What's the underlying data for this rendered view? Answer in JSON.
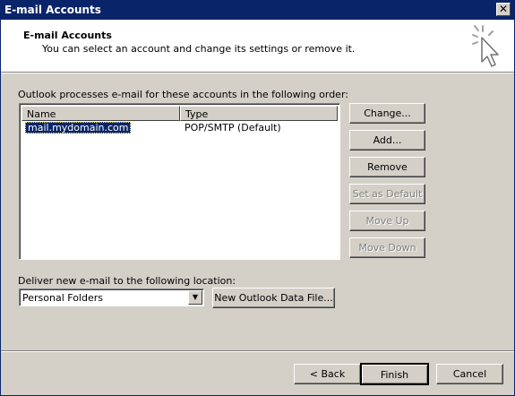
{
  "window": {
    "title": "E-mail Accounts",
    "close_glyph": "✕"
  },
  "header": {
    "title": "E-mail Accounts",
    "subtitle": "You can select an account and change its settings or remove it.",
    "icon": "cursor-sparkle-icon"
  },
  "accounts": {
    "label": "Outlook processes e-mail for these accounts in the following order:",
    "columns": [
      "Name",
      "Type"
    ],
    "rows": [
      {
        "name": "mail.mydomain.com",
        "type": "POP/SMTP (Default)"
      }
    ]
  },
  "side_buttons": {
    "change": "Change...",
    "add": "Add...",
    "remove": "Remove",
    "set_default": "Set as Default",
    "move_up": "Move Up",
    "move_down": "Move Down"
  },
  "delivery": {
    "label": "Deliver new e-mail to the following location:",
    "selected": "Personal Folders",
    "new_file_button": "New Outlook Data File..."
  },
  "footer": {
    "back": "< Back",
    "finish": "Finish",
    "cancel": "Cancel"
  }
}
